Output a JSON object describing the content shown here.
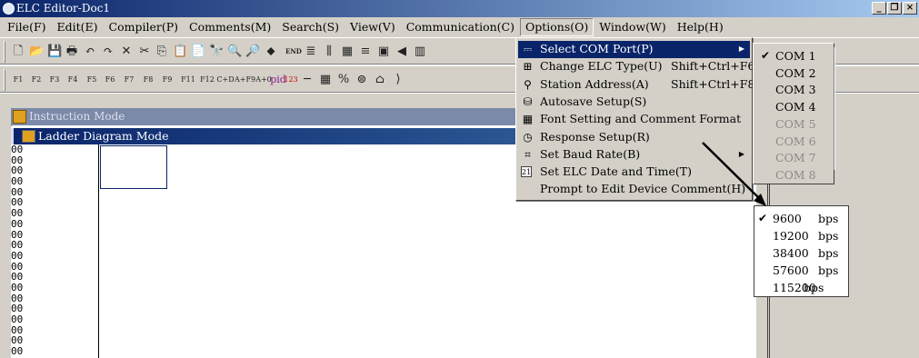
{
  "window": {
    "title": "ELC Editor-Doc1",
    "buttons": [
      "_",
      "❐",
      "×"
    ]
  },
  "menubar": [
    {
      "label": "File(F)"
    },
    {
      "label": "Edit(E)"
    },
    {
      "label": "Compiler(P)"
    },
    {
      "label": "Comments(M)"
    },
    {
      "label": "Search(S)"
    },
    {
      "label": "View(V)"
    },
    {
      "label": "Communication(C)"
    },
    {
      "label": "Options(O)",
      "open": true
    },
    {
      "label": "Window(W)"
    },
    {
      "label": "Help(H)"
    }
  ],
  "toolbar1": {
    "icons": [
      "new-file-icon",
      "open-folder-icon",
      "save-icon",
      "print-icon",
      "undo-icon",
      "redo-icon",
      "delete-icon",
      "cut-icon",
      "copy-icon",
      "paste-icon",
      "paste-special-icon",
      "binoculars-icon",
      "zoom-in-icon",
      "zoom-out-icon",
      "eraser-icon",
      "ld-end-icon",
      "ladder-icon",
      "ladder-edit-icon",
      "grid-icon",
      "list-icon",
      "block-icon",
      "arrow-left-icon",
      "ladder-run-icon"
    ],
    "glyphs": [
      "🗋",
      "📂",
      "💾",
      "🖶",
      "↶",
      "↷",
      "✕",
      "✂",
      "⎘",
      "📋",
      "📄",
      "🔭",
      "🔍",
      "🔎",
      "⬥",
      "END",
      "≣",
      "⫼",
      "▦",
      "≡",
      "▣",
      "◀",
      "▥"
    ]
  },
  "toolbar2": {
    "glyphs": [
      "F1",
      "F2",
      "F3",
      "F4",
      "F5",
      "F6",
      "F7",
      "F8",
      "F9",
      "F11",
      "F12",
      "C+D",
      "A+F9",
      "A+0",
      "pid",
      "123",
      "─",
      "▦",
      "%",
      "⊜",
      "⌂",
      "⟩"
    ],
    "pid_label": "pid"
  },
  "instruction_window": {
    "title": "Instruction Mode"
  },
  "ladder_window": {
    "title": "Ladder Diagram Mode",
    "row_numbers": [
      "00",
      "00",
      "00",
      "00",
      "00",
      "00",
      "00",
      "00",
      "00",
      "00",
      "00",
      "00",
      "00",
      "00",
      "00",
      "00",
      "00",
      "00",
      "00",
      "00"
    ]
  },
  "options_menu": {
    "items": [
      {
        "icon": "com-port-icon",
        "glyph": "⎓",
        "label": "Select COM Port(P)",
        "shortcut": "",
        "submenu": true,
        "highlighted": true
      },
      {
        "icon": "elc-type-icon",
        "glyph": "⊞",
        "label": "Change ELC Type(U)",
        "shortcut": "Shift+Ctrl+F6",
        "submenu": false
      },
      {
        "icon": "station-icon",
        "glyph": "⚲",
        "label": "Station Address(A)",
        "shortcut": "Shift+Ctrl+F8",
        "submenu": false
      },
      {
        "icon": "autosave-icon",
        "glyph": "⛁",
        "label": "Autosave Setup(S)",
        "shortcut": "",
        "submenu": false
      },
      {
        "icon": "font-icon",
        "glyph": "▦",
        "label": "Font Setting and Comment Format",
        "shortcut": "",
        "submenu": false
      },
      {
        "icon": "clock-icon",
        "glyph": "◷",
        "label": "Response Setup(R)",
        "shortcut": "",
        "submenu": false
      },
      {
        "icon": "baud-icon",
        "glyph": "⌗",
        "label": "Set Baud Rate(B)",
        "shortcut": "",
        "submenu": true
      },
      {
        "icon": "calendar-icon",
        "glyph": "21",
        "label": "Set ELC Date and Time(T)",
        "shortcut": "",
        "submenu": false
      },
      {
        "icon": "",
        "glyph": "",
        "label": "Prompt to Edit Device Comment(H)",
        "shortcut": "",
        "submenu": false
      }
    ]
  },
  "com_ports": {
    "items": [
      {
        "label": "COM 1",
        "checked": true,
        "enabled": true
      },
      {
        "label": "COM 2",
        "checked": false,
        "enabled": true
      },
      {
        "label": "COM 3",
        "checked": false,
        "enabled": true
      },
      {
        "label": "COM 4",
        "checked": false,
        "enabled": true
      },
      {
        "label": "COM 5",
        "checked": false,
        "enabled": false
      },
      {
        "label": "COM 6",
        "checked": false,
        "enabled": false
      },
      {
        "label": "COM 7",
        "checked": false,
        "enabled": false
      },
      {
        "label": "COM 8",
        "checked": false,
        "enabled": false
      }
    ]
  },
  "baud_rates": {
    "unit": "bps",
    "items": [
      {
        "value": "9600",
        "checked": true
      },
      {
        "value": "19200",
        "checked": false
      },
      {
        "value": "38400",
        "checked": false
      },
      {
        "value": "57600",
        "checked": false
      },
      {
        "value": "115200",
        "checked": false
      }
    ]
  },
  "colors": {
    "titlebar_start": "#0a246a",
    "titlebar_end": "#a6caf0",
    "menu_face": "#d4d0c8",
    "highlight": "#0a246a",
    "disabled_text": "#8c8a84"
  }
}
